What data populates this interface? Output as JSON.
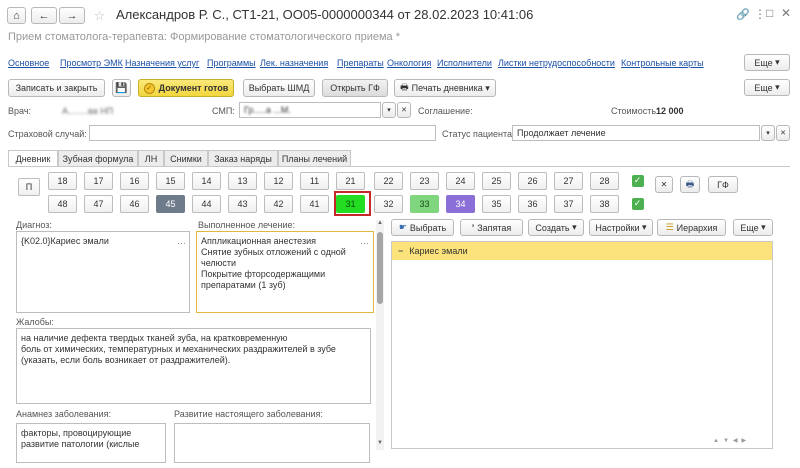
{
  "window": {
    "title": "Александров Р. С., СТ1-21, ОО05-0000000344 от 28.02.2023 10:41:06",
    "subtitle": "Прием стоматолога-терапевта: Формирование стоматологического приема *"
  },
  "links": [
    "Основное",
    "Просмотр ЭМК",
    "Назначения услуг",
    "Программы",
    "Лек. назначения",
    "Препараты",
    "Онкология",
    "Исполнители",
    "Листки нетрудоспособности",
    "Контрольные карты"
  ],
  "more_label": "Еще",
  "toolbar": {
    "save_close": "Записать и закрыть",
    "doc_ready": "Документ готов",
    "choose_shmd": "Выбрать ШМД",
    "open_gf": "Открыть ГФ",
    "print_diary": "Печать дневника"
  },
  "fields": {
    "doctor_label": "Врач:",
    "doctor_value": "А........ва НП",
    "smp_label": "СМП:",
    "smp_value": "Гр.....а ...М.",
    "agreement_label": "Соглашение:",
    "cost_label": "Стоимость:",
    "cost_value": "12 000",
    "insurance_label": "Страховой случай:",
    "status_label": "Статус пациента:",
    "status_value": "Продолжает лечение"
  },
  "tabs": [
    "Дневник",
    "Зубная формула",
    "ЛН",
    "Снимки",
    "Заказ наряды",
    "Планы лечений"
  ],
  "teeth": {
    "p_label": "П",
    "upper": [
      "18",
      "17",
      "16",
      "15",
      "14",
      "13",
      "12",
      "11",
      "21",
      "22",
      "23",
      "24",
      "25",
      "26",
      "27",
      "28"
    ],
    "lower": [
      "48",
      "47",
      "46",
      "45",
      "44",
      "43",
      "42",
      "41",
      "31",
      "32",
      "33",
      "34",
      "35",
      "36",
      "37",
      "38"
    ],
    "highlight_colors": {
      "45": "#6e7b8b",
      "31": "#22dd22",
      "33": "#7fd67f",
      "34": "#8a6fd6"
    },
    "selected": "31",
    "gf_label": "ГФ"
  },
  "diagnosis": {
    "label": "Диагноз:",
    "value": "{K02.0}Кариес эмали"
  },
  "treatment": {
    "label": "Выполненное лечение:",
    "lines": [
      "Аппликационная анестезия",
      "Снятие зубных отложений с одной",
      "челюсти",
      "Покрытие фторсодержащими",
      "препаратами (1 зуб)"
    ]
  },
  "right_panel": {
    "choose": "Выбрать",
    "comma": "Запятая",
    "create": "Создать",
    "settings": "Настройки",
    "hierarchy": "Иерархия",
    "more": "Еще",
    "tree_item": "Кариес эмали"
  },
  "complaints": {
    "label": "Жалобы:",
    "lines": [
      "на наличие дефекта твердых тканей зуба, на кратковременную",
      "боль от химических, температурных и механических раздражителей в зубе",
      "(указать, если боль возникает от раздражителей)."
    ]
  },
  "anamnesis": {
    "label": "Анамнез заболевания:",
    "lines": [
      "факторы, провоцирующие",
      "развитие патологии (кислые"
    ]
  },
  "development": {
    "label": "Развитие настоящего заболевания:"
  }
}
